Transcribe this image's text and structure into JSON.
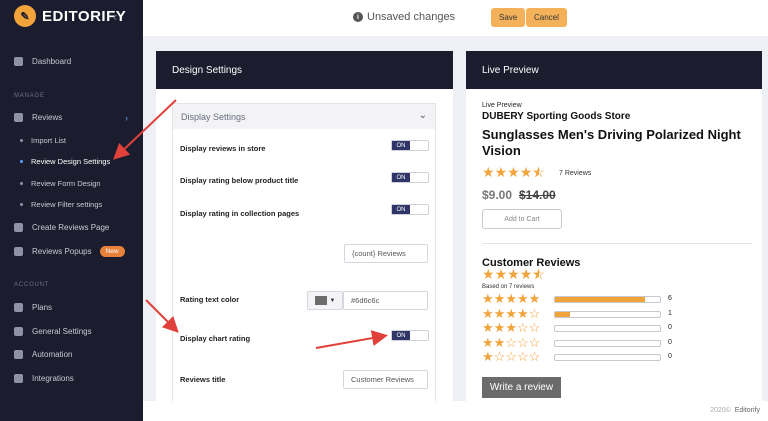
{
  "app": {
    "logo_text": "EDITORIFY",
    "collapse_glyph": "‹"
  },
  "sidebar": {
    "dashboard": "Dashboard",
    "manage_section": "MANAGE",
    "reviews": "Reviews",
    "sub_items": [
      "Import List",
      "Review Design Settings",
      "Review Form Design",
      "Review Filter settings"
    ],
    "create_reviews_page": "Create Reviews Page",
    "reviews_popups": "Reviews Popups",
    "new_badge": "New",
    "account_section": "ACCOUNT",
    "plans": "Plans",
    "general_settings": "General Settings",
    "automation": "Automation",
    "integrations": "Integrations"
  },
  "topbar": {
    "status": "Unsaved changes",
    "save": "Save",
    "cancel": "Cancel"
  },
  "design": {
    "panel_title": "Design Settings",
    "section_title": "Display Settings",
    "show_in_store": "Display reviews in store",
    "rating_below_title": "Display rating below product title",
    "rating_collection": "Display rating in collection pages",
    "count_format": "{count} Reviews",
    "rating_color_label": "Rating text color",
    "rating_color_value": "#6d6c6c",
    "chart_rating": "Display chart rating",
    "reviews_title_label": "Reviews title",
    "reviews_title_value": "Customer Reviews",
    "toggle_on": "ON"
  },
  "preview": {
    "panel_title": "Live Preview",
    "small_label": "Live Preview",
    "store": "DUBERY Sporting Goods Store",
    "product": "Sunglasses Men's Driving Polarized Night Vision",
    "reviews_count": "7 Reviews",
    "price": "$9.00",
    "old_price": "$14.00",
    "add_to_cart": "Add to Cart",
    "customer_reviews": "Customer Reviews",
    "based_on": "Based on 7 reviews",
    "write_review": "Write a review",
    "rating": 4.5,
    "star_color": "#f2a33a",
    "distribution": [
      {
        "stars": 5,
        "count": "6",
        "fraction": 0.857
      },
      {
        "stars": 4,
        "count": "1",
        "fraction": 0.143
      },
      {
        "stars": 3,
        "count": "0",
        "fraction": 0
      },
      {
        "stars": 2,
        "count": "0",
        "fraction": 0
      },
      {
        "stars": 1,
        "count": "0",
        "fraction": 0
      }
    ]
  },
  "footer": {
    "year": "2020©",
    "brand": "Editorify"
  }
}
